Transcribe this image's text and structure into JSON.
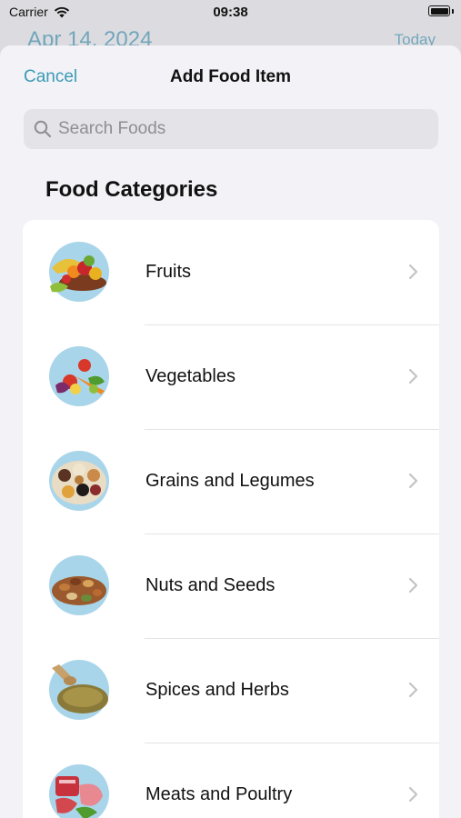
{
  "status_bar": {
    "carrier": "Carrier",
    "time": "09:38"
  },
  "background": {
    "date": "Apr 14, 2024",
    "today": "Today"
  },
  "nav": {
    "cancel_label": "Cancel",
    "title": "Add Food Item"
  },
  "search": {
    "placeholder": "Search Foods",
    "value": ""
  },
  "section": {
    "title": "Food Categories"
  },
  "categories": [
    {
      "label": "Fruits",
      "icon": "fruit-bowl-icon"
    },
    {
      "label": "Vegetables",
      "icon": "vegetables-icon"
    },
    {
      "label": "Grains and Legumes",
      "icon": "grains-legumes-icon"
    },
    {
      "label": "Nuts and Seeds",
      "icon": "nuts-seeds-icon"
    },
    {
      "label": "Spices and Herbs",
      "icon": "spices-herbs-icon"
    },
    {
      "label": "Meats and Poultry",
      "icon": "meats-poultry-icon"
    }
  ],
  "colors": {
    "accent": "#3a9bb4",
    "sheet_bg": "#f2f2f7",
    "list_bg": "#ffffff",
    "thumb_circle": "#a9d5ea"
  }
}
